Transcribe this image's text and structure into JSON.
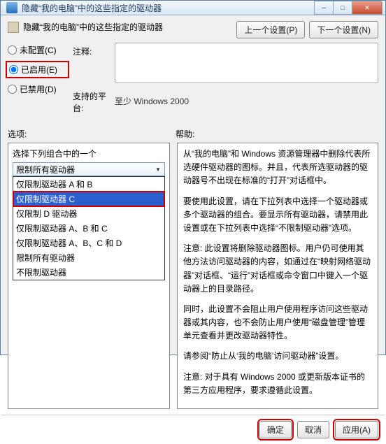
{
  "title": "隐藏“我的电脑”中的这些指定的驱动器",
  "header_label": "隐藏“我的电脑”中的这些指定的驱动器",
  "nav": {
    "prev": "上一个设置(P)",
    "next": "下一个设置(N)"
  },
  "radios": {
    "unconfigured": "未配置(C)",
    "enabled": "已启用(E)",
    "disabled": "已禁用(D)"
  },
  "fields": {
    "comment_label": "注释:",
    "platform_label": "支持的平台:",
    "platform_value": "至少 Windows 2000"
  },
  "labels": {
    "options": "选项:",
    "help": "帮助:"
  },
  "left": {
    "caption": "选择下列组合中的一个",
    "selected": "限制所有驱动器",
    "items": [
      "仅限制驱动器 A 和 B",
      "仅限制驱动器 C",
      "仅限制 D 驱动器",
      "仅限制驱动器 A、B 和 C",
      "仅限制驱动器 A、B、C 和 D",
      "限制所有驱动器",
      "不限制驱动器"
    ],
    "selected_index": 1
  },
  "help_paragraphs": [
    "从“我的电脑”和 Windows 资源管理器中删除代表所选硬件驱动器的图标。并且，代表所选驱动器的驱动器号不出现在标准的“打开”对话框中。",
    "要使用此设置，请在下拉列表中选择一个驱动器或多个驱动器的组合。要显示所有驱动器，请禁用此设置或在下拉列表中选择“不限制驱动器”选项。",
    "注意: 此设置将删除驱动器图标。用户仍可使用其他方法访问驱动器的内容，如通过在“映射网络驱动器”对话框、“运行”对话框或命令窗口中键入一个驱动器上的目录路径。",
    "同时，此设置不会阻止用户使用程序访问这些驱动器或其内容，也不会防止用户使用“磁盘管理”管理单元查看并更改驱动器特性。",
    "请参阅“防止从‘我的电脑’访问驱动器”设置。",
    "注意: 对于具有 Windows 2000 或更新版本证书的第三方应用程序，要求遵循此设置。"
  ],
  "footer": {
    "ok": "确定",
    "cancel": "取消",
    "apply": "应用(A)"
  }
}
